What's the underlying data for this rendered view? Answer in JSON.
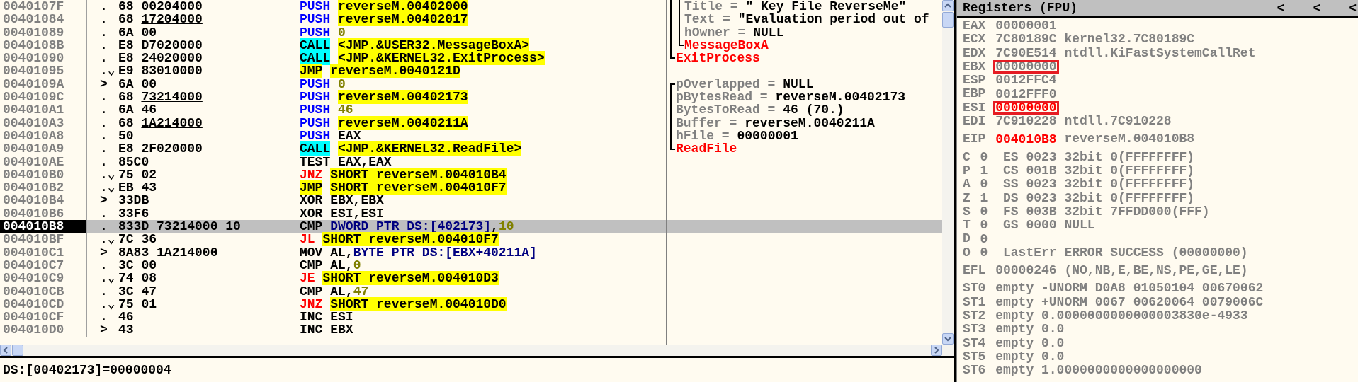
{
  "disasm": {
    "rows": [
      {
        "address": "0040107F",
        "marker": ".",
        "hex": {
          "op": "68",
          "arg": "00204000",
          "link": true
        },
        "mnemonic": "PUSH",
        "kind": "push",
        "operands": [
          {
            "text": "reverseM.00402000",
            "kind": "symbol"
          }
        ],
        "selected": false
      },
      {
        "address": "00401084",
        "marker": ".",
        "hex": {
          "op": "68",
          "arg": "17204000",
          "link": true
        },
        "mnemonic": "PUSH",
        "kind": "push",
        "operands": [
          {
            "text": "reverseM.00402017",
            "kind": "symbol"
          }
        ],
        "selected": false
      },
      {
        "address": "00401089",
        "marker": ".",
        "hex": {
          "op": "6A",
          "arg": "00",
          "link": false
        },
        "mnemonic": "PUSH",
        "kind": "push",
        "operands": [
          {
            "text": "0",
            "kind": "const"
          }
        ],
        "selected": false
      },
      {
        "address": "0040108B",
        "marker": ".",
        "hex": {
          "op": "E8",
          "arg": "D7020000",
          "link": false
        },
        "mnemonic": "CALL",
        "kind": "call",
        "operands": [
          {
            "text": "<JMP.&USER32.MessageBoxA>",
            "kind": "symbol"
          }
        ],
        "selected": false
      },
      {
        "address": "00401090",
        "marker": ".",
        "hex": {
          "op": "E8",
          "arg": "24020000",
          "link": false
        },
        "mnemonic": "CALL",
        "kind": "call",
        "operands": [
          {
            "text": "<JMP.&KERNEL32.ExitProcess>",
            "kind": "symbol"
          }
        ],
        "selected": false
      },
      {
        "address": "00401095",
        "marker": ".⌄",
        "hex": {
          "op": "E9",
          "arg": "83010000",
          "link": false
        },
        "mnemonic": "JMP",
        "kind": "jmp",
        "operands": [
          {
            "text": "reverseM.0040121D",
            "kind": "symbol"
          }
        ],
        "selected": false
      },
      {
        "address": "0040109A",
        "marker": ">",
        "hex": {
          "op": "6A",
          "arg": "00",
          "link": false
        },
        "mnemonic": "PUSH",
        "kind": "push",
        "operands": [
          {
            "text": "0",
            "kind": "const"
          }
        ],
        "selected": false
      },
      {
        "address": "0040109C",
        "marker": ".",
        "hex": {
          "op": "68",
          "arg": "73214000",
          "link": true
        },
        "mnemonic": "PUSH",
        "kind": "push",
        "operands": [
          {
            "text": "reverseM.00402173",
            "kind": "symbol"
          }
        ],
        "selected": false
      },
      {
        "address": "004010A1",
        "marker": ".",
        "hex": {
          "op": "6A",
          "arg": "46",
          "link": false
        },
        "mnemonic": "PUSH",
        "kind": "push",
        "operands": [
          {
            "text": "46",
            "kind": "const"
          }
        ],
        "selected": false
      },
      {
        "address": "004010A3",
        "marker": ".",
        "hex": {
          "op": "68",
          "arg": "1A214000",
          "link": true
        },
        "mnemonic": "PUSH",
        "kind": "push",
        "operands": [
          {
            "text": "reverseM.0040211A",
            "kind": "symbol"
          }
        ],
        "selected": false
      },
      {
        "address": "004010A8",
        "marker": ".",
        "hex": {
          "op": "50"
        },
        "mnemonic": "PUSH",
        "kind": "push",
        "operands": [
          {
            "text": "EAX",
            "kind": "plain"
          }
        ],
        "selected": false
      },
      {
        "address": "004010A9",
        "marker": ".",
        "hex": {
          "op": "E8",
          "arg": "2F020000",
          "link": false
        },
        "mnemonic": "CALL",
        "kind": "call",
        "operands": [
          {
            "text": "<JMP.&KERNEL32.ReadFile>",
            "kind": "symbol"
          }
        ],
        "selected": false
      },
      {
        "address": "004010AE",
        "marker": ".",
        "hex": {
          "op": "85C0"
        },
        "mnemonic": "TEST",
        "kind": "plain",
        "operands": [
          {
            "text": "EAX,EAX",
            "kind": "plain"
          }
        ],
        "selected": false
      },
      {
        "address": "004010B0",
        "marker": ".⌄",
        "hex": {
          "op": "75",
          "arg": "02",
          "link": false
        },
        "mnemonic": "JNZ",
        "kind": "jcc",
        "operands": [
          {
            "text": "SHORT reverseM.004010B4",
            "kind": "symbol"
          }
        ],
        "selected": false
      },
      {
        "address": "004010B2",
        "marker": ".⌄",
        "hex": {
          "op": "EB",
          "arg": "43",
          "link": false
        },
        "mnemonic": "JMP",
        "kind": "jmp",
        "operands": [
          {
            "text": "SHORT reverseM.004010F7",
            "kind": "symbol"
          }
        ],
        "selected": false
      },
      {
        "address": "004010B4",
        "marker": ">",
        "hex": {
          "op": "33DB"
        },
        "mnemonic": "XOR",
        "kind": "plain",
        "operands": [
          {
            "text": "EBX,EBX",
            "kind": "plain"
          }
        ],
        "selected": false
      },
      {
        "address": "004010B6",
        "marker": ".",
        "hex": {
          "op": "33F6"
        },
        "mnemonic": "XOR",
        "kind": "plain",
        "operands": [
          {
            "text": "ESI,ESI",
            "kind": "plain"
          }
        ],
        "selected": false
      },
      {
        "address": "004010B8",
        "marker": ".",
        "hex": {
          "op": "833D",
          "arg": "73214000",
          "link": true,
          "tail": "10"
        },
        "mnemonic": "CMP",
        "kind": "plain",
        "operands": [
          {
            "text": "DWORD PTR DS:[402173]",
            "kind": "mem"
          },
          {
            "text": ",",
            "kind": "plain"
          },
          {
            "text": "10",
            "kind": "const"
          }
        ],
        "selected": true
      },
      {
        "address": "004010BF",
        "marker": ".⌄",
        "hex": {
          "op": "7C",
          "arg": "36",
          "link": false
        },
        "mnemonic": "JL",
        "kind": "jcc",
        "operands": [
          {
            "text": "SHORT reverseM.004010F7",
            "kind": "symbol"
          }
        ],
        "selected": false
      },
      {
        "address": "004010C1",
        "marker": ">",
        "hex": {
          "op": "8A83",
          "arg": "1A214000",
          "link": true
        },
        "mnemonic": "MOV",
        "kind": "plain",
        "operands": [
          {
            "text": "AL,",
            "kind": "plain"
          },
          {
            "text": "BYTE PTR DS:[EBX+40211A]",
            "kind": "mem"
          }
        ],
        "selected": false
      },
      {
        "address": "004010C7",
        "marker": ".",
        "hex": {
          "op": "3C",
          "arg": "00",
          "link": false
        },
        "mnemonic": "CMP",
        "kind": "plain",
        "operands": [
          {
            "text": "AL,",
            "kind": "plain"
          },
          {
            "text": "0",
            "kind": "const"
          }
        ],
        "selected": false
      },
      {
        "address": "004010C9",
        "marker": ".⌄",
        "hex": {
          "op": "74",
          "arg": "08",
          "link": false
        },
        "mnemonic": "JE",
        "kind": "jcc",
        "operands": [
          {
            "text": "SHORT reverseM.004010D3",
            "kind": "symbol"
          }
        ],
        "selected": false
      },
      {
        "address": "004010CB",
        "marker": ".",
        "hex": {
          "op": "3C",
          "arg": "47",
          "link": false
        },
        "mnemonic": "CMP",
        "kind": "plain",
        "operands": [
          {
            "text": "AL,",
            "kind": "plain"
          },
          {
            "text": "47",
            "kind": "const"
          }
        ],
        "selected": false
      },
      {
        "address": "004010CD",
        "marker": ".⌄",
        "hex": {
          "op": "75",
          "arg": "01",
          "link": false
        },
        "mnemonic": "JNZ",
        "kind": "jcc",
        "operands": [
          {
            "text": "SHORT reverseM.004010D0",
            "kind": "symbol"
          }
        ],
        "selected": false
      },
      {
        "address": "004010CF",
        "marker": ".",
        "hex": {
          "op": "46"
        },
        "mnemonic": "INC",
        "kind": "plain",
        "operands": [
          {
            "text": "ESI",
            "kind": "plain"
          }
        ],
        "selected": false
      },
      {
        "address": "004010D0",
        "marker": ">",
        "hex": {
          "op": "43"
        },
        "mnemonic": "INC",
        "kind": "plain",
        "operands": [
          {
            "text": "EBX",
            "kind": "plain"
          }
        ],
        "selected": false
      }
    ],
    "comments": [
      {
        "function": "ExitProcess",
        "open_top": true,
        "children": [
          {
            "function": "MessageBoxA",
            "open_top": true,
            "args": [
              {
                "label": "Title =",
                "value": "\" Key File ReverseMe\""
              },
              {
                "label": "Text =",
                "value": "\"Evaluation period out of"
              },
              {
                "label": "hOwner =",
                "value": "NULL"
              }
            ]
          }
        ]
      },
      {
        "function": "ReadFile",
        "open_top": false,
        "args": [
          {
            "label": "pOverlapped =",
            "value": "NULL"
          },
          {
            "label": "pBytesRead =",
            "value": "reverseM.00402173"
          },
          {
            "label": "BytesToRead =",
            "value": "46 (70.)"
          },
          {
            "label": "Buffer =",
            "value": "reverseM.0040211A"
          },
          {
            "label": "hFile =",
            "value": "00000001"
          }
        ]
      }
    ]
  },
  "status_bar": {
    "text": "DS:[00402173]=00000004"
  },
  "registers": {
    "title": "Registers (FPU)",
    "buttons": [
      "<",
      "<",
      "<"
    ],
    "sections": [
      {
        "kind": "gpr",
        "rows": [
          {
            "name": "EAX",
            "value": "00000001",
            "changed": false,
            "boxed": false
          },
          {
            "name": "ECX",
            "value": "7C80189C",
            "comment": "kernel32.7C80189C",
            "changed": false,
            "boxed": false
          },
          {
            "name": "EDX",
            "value": "7C90E514",
            "comment": "ntdll.KiFastSystemCallRet",
            "changed": false,
            "boxed": false
          },
          {
            "name": "EBX",
            "value": "00000000",
            "changed": false,
            "boxed": true
          },
          {
            "name": "ESP",
            "value": "0012FFC4",
            "changed": false,
            "boxed": false
          },
          {
            "name": "EBP",
            "value": "0012FFF0",
            "changed": false,
            "boxed": false
          },
          {
            "name": "ESI",
            "value": "00000000",
            "changed": true,
            "boxed": true
          },
          {
            "name": "EDI",
            "value": "7C910228",
            "comment": "ntdll.7C910228",
            "changed": false,
            "boxed": false
          }
        ]
      },
      {
        "kind": "gpr",
        "rows": [
          {
            "name": "EIP",
            "value": "004010B8",
            "comment": "reverseM.004010B8",
            "changed": true,
            "boxed": false
          }
        ]
      },
      {
        "kind": "flags",
        "rows": [
          {
            "name": "C",
            "value": "0",
            "comment": "ES 0023 32bit 0(FFFFFFFF)",
            "changed": false,
            "boxed": false
          },
          {
            "name": "P",
            "value": "1",
            "comment": "CS 001B 32bit 0(FFFFFFFF)",
            "changed": false,
            "boxed": false
          },
          {
            "name": "A",
            "value": "0",
            "comment": "SS 0023 32bit 0(FFFFFFFF)",
            "changed": false,
            "boxed": false
          },
          {
            "name": "Z",
            "value": "1",
            "comment": "DS 0023 32bit 0(FFFFFFFF)",
            "changed": false,
            "boxed": false
          },
          {
            "name": "S",
            "value": "0",
            "comment": "FS 003B 32bit 7FFDD000(FFF)",
            "changed": false,
            "boxed": false
          },
          {
            "name": "T",
            "value": "0",
            "comment": "GS 0000 NULL",
            "changed": false,
            "boxed": false
          },
          {
            "name": "D",
            "value": "0",
            "changed": false,
            "boxed": false
          },
          {
            "name": "O",
            "value": "0",
            "comment": "LastErr ERROR_SUCCESS (00000000)",
            "changed": false,
            "boxed": false
          }
        ]
      },
      {
        "kind": "gpr",
        "rows": [
          {
            "name": "EFL",
            "value": "00000246",
            "comment": "(NO,NB,E,BE,NS,PE,GE,LE)",
            "changed": false,
            "boxed": false
          }
        ]
      },
      {
        "kind": "gpr",
        "rows": [
          {
            "name": "ST0",
            "value": "empty",
            "comment": "-UNORM D0A8 01050104 00670062",
            "changed": false,
            "boxed": false
          },
          {
            "name": "ST1",
            "value": "empty",
            "comment": "+UNORM 0067 00620064 0079006C",
            "changed": false,
            "boxed": false
          },
          {
            "name": "ST2",
            "value": "empty",
            "comment": "0.0000000000000003830e-4933",
            "changed": false,
            "boxed": false
          },
          {
            "name": "ST3",
            "value": "empty",
            "comment": "0.0",
            "changed": false,
            "boxed": false
          },
          {
            "name": "ST4",
            "value": "empty",
            "comment": "0.0",
            "changed": false,
            "boxed": false
          },
          {
            "name": "ST5",
            "value": "empty",
            "comment": "0.0",
            "changed": false,
            "boxed": false
          },
          {
            "name": "ST6",
            "value": "empty",
            "comment": "1.0000000000000000000",
            "changed": false,
            "boxed": false
          }
        ]
      }
    ]
  }
}
